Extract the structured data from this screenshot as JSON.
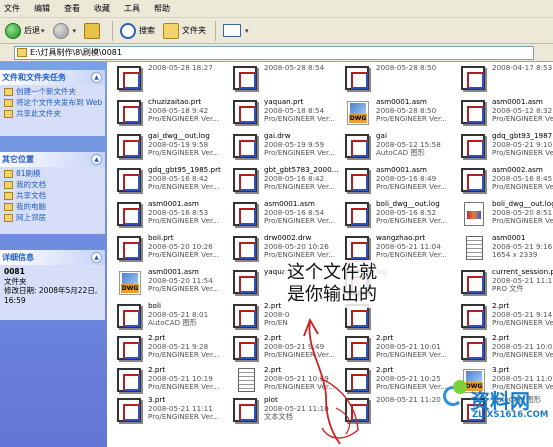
{
  "menubar": {
    "items": [
      "文件",
      "编辑",
      "查看",
      "收藏",
      "工具",
      "帮助"
    ]
  },
  "toolbar": {
    "back_label": "后退",
    "search_label": "搜索",
    "folders_label": "文件夹"
  },
  "address": {
    "path": "E:\\灯具制作\\8\\刷模\\0081"
  },
  "sidebar": {
    "tasks": {
      "title": "文件和文件夹任务",
      "items": [
        "创建一个新文件夹",
        "将这个文件夹发布到 Web",
        "共享此文件夹"
      ]
    },
    "places": {
      "title": "其它位置",
      "items": [
        "81刷模",
        "我的文档",
        "共享文档",
        "我的电脑",
        "网上邻居"
      ]
    },
    "details": {
      "title": "详细信息",
      "name": "0081",
      "type": "文件夹",
      "modified": "修改日期: 2008年5月22日, 16:59"
    }
  },
  "files": [
    {
      "name": "",
      "sub": "2008-05-28 18:27"
    },
    {
      "name": "",
      "sub": "2008-05-28 8:54"
    },
    {
      "name": "",
      "sub": "2008-05-28 8:50"
    },
    {
      "name": "",
      "sub": "2008-04-17 8:53"
    },
    {
      "name": "",
      "sub": "Pro/ENGINEER Ver..."
    },
    {
      "name": "",
      "sub": "Pro/ENGINEER Ver..."
    },
    {
      "name": "",
      "sub": "Pro/ENGINEER Ver..."
    },
    {
      "name": "",
      "sub": "Pro/ENGINEER Ver..."
    },
    {
      "name": "chuzizaitao.prt",
      "sub": "2008-05-18 9:42"
    },
    {
      "name": "yaquan.prt",
      "sub": "2008-05-18 8:54"
    },
    {
      "name": "asm0001.asm",
      "sub": "2008-05-28 8:50"
    },
    {
      "name": "asm0001.asm",
      "sub": "2008-05-12 8:32"
    },
    {
      "name": "Pro/ENGINEER Ver...",
      "sub": ""
    },
    {
      "name": "Pro/ENGINEER Ver...",
      "sub": ""
    },
    {
      "name": "Pro/ENGINEER Ver...",
      "sub": ""
    },
    {
      "name": "Pro/ENGINEER Ver...",
      "sub": ""
    },
    {
      "name": "gai_dwg__out.log",
      "sub": "2008-05-19 9:58"
    },
    {
      "name": "gai.drw",
      "sub": "2008-05-19 9:59"
    },
    {
      "name": "gai",
      "sub": "2008-05-12 15:58"
    },
    {
      "name": "gdq_gbt93_1987.prt",
      "sub": "2008-05-21 9:10"
    },
    {
      "name": "Pro/ENGINEER Ver...",
      "sub": ""
    },
    {
      "name": "Pro/ENGINEER Ver...",
      "sub": ""
    },
    {
      "name": "AutoCAD 图形",
      "sub": ""
    },
    {
      "name": "Pro/ENGINEER Ver...",
      "sub": ""
    },
    {
      "name": "gdq_gbt95_1985.prt",
      "sub": "2008-05-16 8:42"
    },
    {
      "name": "gbt_gbt5783_2000...",
      "sub": "2008-05-16 8:42"
    },
    {
      "name": "asm0001.asm",
      "sub": "2008-05-16 8:49"
    },
    {
      "name": "asm0002.asm",
      "sub": "2008-05-16 8:45"
    },
    {
      "name": "Pro/ENGINEER Ver...",
      "sub": ""
    },
    {
      "name": "Pro/ENGINEER Ver...",
      "sub": ""
    },
    {
      "name": "Pro/ENGINEER Ver...",
      "sub": ""
    },
    {
      "name": "Pro/ENGINEER Ver...",
      "sub": ""
    },
    {
      "name": "asm0001.asm",
      "sub": "2008-05-16 8:53"
    },
    {
      "name": "asm0001.asm",
      "sub": "2008-05-16 8:54"
    },
    {
      "name": "boli_dwg__out.log",
      "sub": "2008-05-16 8:52"
    },
    {
      "name": "boli_dwg__out.log",
      "sub": "2008-05-20 8:51"
    },
    {
      "name": "Pro/ENGINEER Ver...",
      "sub": ""
    },
    {
      "name": "Pro/ENGINEER Ver...",
      "sub": ""
    },
    {
      "name": "Pro/ENGINEER Ver...",
      "sub": ""
    },
    {
      "name": "Pro/ENGINEER Ver...",
      "sub": ""
    },
    {
      "name": "boli.prt",
      "sub": "2008-05-20 10:26"
    },
    {
      "name": "drw0002.drw",
      "sub": "2008-05-20 10:26"
    },
    {
      "name": "wangzhao.prt",
      "sub": "2008-05-21 11:04"
    },
    {
      "name": "asm0001",
      "sub": "2008-05-21 9:16"
    },
    {
      "name": "Pro/ENGINEER Ver...",
      "sub": ""
    },
    {
      "name": "Pro/ENGINEER Ver...",
      "sub": ""
    },
    {
      "name": "Pro/ENGINEER Ver...",
      "sub": ""
    },
    {
      "name": "1654 x 2339",
      "sub": ""
    },
    {
      "name": "asm0001.asm",
      "sub": "2008-05-20 11:54"
    },
    {
      "name": "yaquan",
      "sub": ""
    },
    {
      "name": "log",
      "sub": ""
    },
    {
      "name": "current_session.pro",
      "sub": "2008-05-21 11:17"
    },
    {
      "name": "Pro/ENGINEER Ver...",
      "sub": ""
    },
    {
      "name": "",
      "sub": ""
    },
    {
      "name": "",
      "sub": ""
    },
    {
      "name": "PRO 文件",
      "sub": ""
    },
    {
      "name": "boli",
      "sub": "2008-05-21 8:01"
    },
    {
      "name": "2.prt",
      "sub": "2008-0"
    },
    {
      "name": "",
      "sub": ""
    },
    {
      "name": "2.prt",
      "sub": "2008-05-21 9:14"
    },
    {
      "name": "AutoCAD 图形",
      "sub": ""
    },
    {
      "name": "Pro/EN",
      "sub": ""
    },
    {
      "name": "",
      "sub": ""
    },
    {
      "name": "Pro/ENGINEER Ver...",
      "sub": ""
    },
    {
      "name": "2.prt",
      "sub": "2008-05-21 9:28"
    },
    {
      "name": "2.prt",
      "sub": "2008-05-21 9:49"
    },
    {
      "name": "2.prt",
      "sub": "2008-05-21 10:01"
    },
    {
      "name": "2.prt",
      "sub": "2008-05-21 10:05"
    },
    {
      "name": "Pro/ENGINEER Ver...",
      "sub": ""
    },
    {
      "name": "Pro/ENGINEER Ver...",
      "sub": ""
    },
    {
      "name": "Pro/ENGINEER Ver...",
      "sub": ""
    },
    {
      "name": "Pro/ENGINEER Ver...",
      "sub": ""
    },
    {
      "name": "2.prt",
      "sub": "2008-05-21 10:19"
    },
    {
      "name": "2.prt",
      "sub": "2008-05-21 10:19"
    },
    {
      "name": "2.prt",
      "sub": "2008-05-21 10:25"
    },
    {
      "name": "3.prt",
      "sub": "2008-05-21 11:07"
    },
    {
      "name": "Pro/ENGINEER Ver...",
      "sub": ""
    },
    {
      "name": "Pro/ENGINEER Ver...",
      "sub": ""
    },
    {
      "name": "Pro/ENGINEER Ver...",
      "sub": ""
    },
    {
      "name": "Pro/ENGINEER Ver...",
      "sub": ""
    },
    {
      "name": "3.prt",
      "sub": "2008-05-21 11:11"
    },
    {
      "name": "plot",
      "sub": "2008-05-21 11:10"
    },
    {
      "name": "",
      "sub": ""
    },
    {
      "name": "",
      "sub": ""
    },
    {
      "name": "Pro/ENGINEER Ver...",
      "sub": ""
    },
    {
      "name": "文本文档",
      "sub": ""
    },
    {
      "name": "2008-05-21 11:20",
      "sub": ""
    },
    {
      "name": "AutoCAD 图形",
      "sub": ""
    }
  ],
  "annotation": {
    "line1": "这个文件就",
    "line2": "是你输出的"
  },
  "watermark": {
    "title": "资料网",
    "url": "ZL.XS1616.COM"
  }
}
